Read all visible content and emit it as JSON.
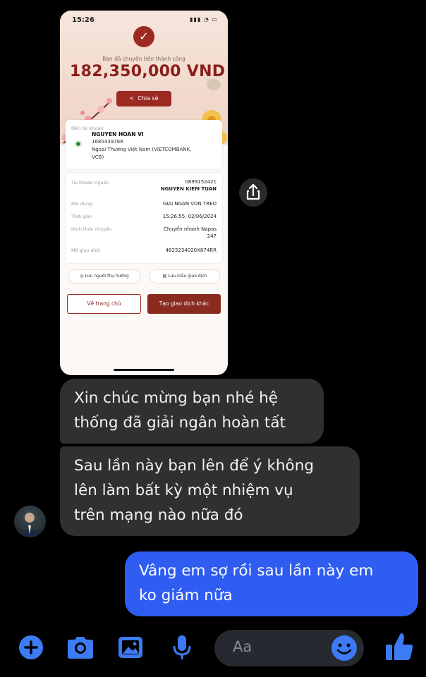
{
  "screenshot": {
    "status_time": "15:26",
    "success_text": "Bạn đã chuyển tiền thành công",
    "amount": "182,350,000 VND",
    "share_label": "Chia sẻ",
    "recipient": {
      "title": "Đến tài khoản",
      "name": "NGUYEN HOAN VI",
      "account": "1685439788",
      "bank_line1": "Ngoại Thương Việt Nam (VIETCOMBANK,",
      "bank_line2": "VCB)"
    },
    "details": [
      {
        "label": "Tài khoản nguồn",
        "value": "0899152421",
        "value2": "NGUYEN KIEM TUAN"
      },
      {
        "label": "Nội dung",
        "value": "GIAI NGAN VON TREO"
      },
      {
        "label": "Thời gian",
        "value": "15:26:55, 02/06/2024"
      },
      {
        "label": "Hình thức chuyển",
        "value": "Chuyển nhanh Napas",
        "value2": "247"
      },
      {
        "label": "Mã giao dịch",
        "value": "4825234020X874RR"
      }
    ],
    "save_beneficiary": "Lưu người thụ hưởng",
    "save_template": "Lưu mẫu giao dịch",
    "home_button": "Về trang chủ",
    "new_transaction_button": "Tạo giao dịch khác"
  },
  "messages": [
    {
      "side": "in",
      "lines": [
        "Xin chúc mừng bạn nhé hệ",
        "thống đã giải ngân hoàn tất"
      ]
    },
    {
      "side": "in",
      "lines": [
        "Sau lần này bạn lên để ý không",
        "lên làm bất kỳ một nhiệm vụ",
        "trên mạng nào nữa đó"
      ]
    },
    {
      "side": "out",
      "lines": [
        "Vâng em sợ rồi sau lần này em",
        "ko giám nữa"
      ]
    }
  ],
  "composer": {
    "placeholder": "Aa",
    "icons": [
      "plus-icon",
      "camera-icon",
      "gallery-icon",
      "microphone-icon",
      "emoji-icon",
      "thumbs-up-icon"
    ]
  },
  "colors": {
    "accent": "#2f5cf1",
    "bank_red": "#9c2a22",
    "incoming_bubble": "#303032"
  }
}
